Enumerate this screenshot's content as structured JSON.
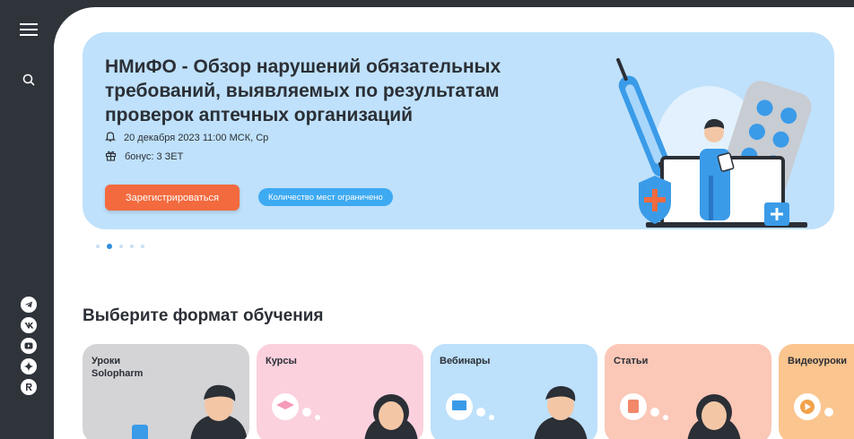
{
  "sidebar": {
    "menu_icon": "menu-icon",
    "search_icon": "search-icon",
    "socials": [
      {
        "name": "telegram-icon"
      },
      {
        "name": "vk-icon"
      },
      {
        "name": "youtube-icon"
      },
      {
        "name": "dzen-icon"
      },
      {
        "name": "rutube-icon"
      }
    ]
  },
  "banner": {
    "title": "НМиФО - Обзор нарушений обязательных требований, выявляемых по результатам проверок аптечных организаций",
    "date": "20 декабря 2023 11:00 МСК, Ср",
    "bonus": "бонус: 3 ЗЕТ",
    "register_label": "Зарегистрироваться",
    "limited_label": "Количество мест ограничено"
  },
  "carousel": {
    "count": 5,
    "active": 2
  },
  "formats": {
    "title": "Выберите формат обучения",
    "cards": [
      {
        "label": "Уроки\nSolopharm",
        "bg": "#d4d4d6"
      },
      {
        "label": "Курсы",
        "bg": "#fbd1de"
      },
      {
        "label": "Вебинары",
        "bg": "#bde0fb"
      },
      {
        "label": "Статьи",
        "bg": "#fbc7b7"
      },
      {
        "label": "Видеоуроки",
        "bg": "#fbc58f"
      }
    ]
  },
  "colors": {
    "sidebar": "#2f343b",
    "accent_orange": "#f26a3e",
    "accent_blue": "#3eaaf2",
    "banner_bg": "#bfe1fb"
  }
}
